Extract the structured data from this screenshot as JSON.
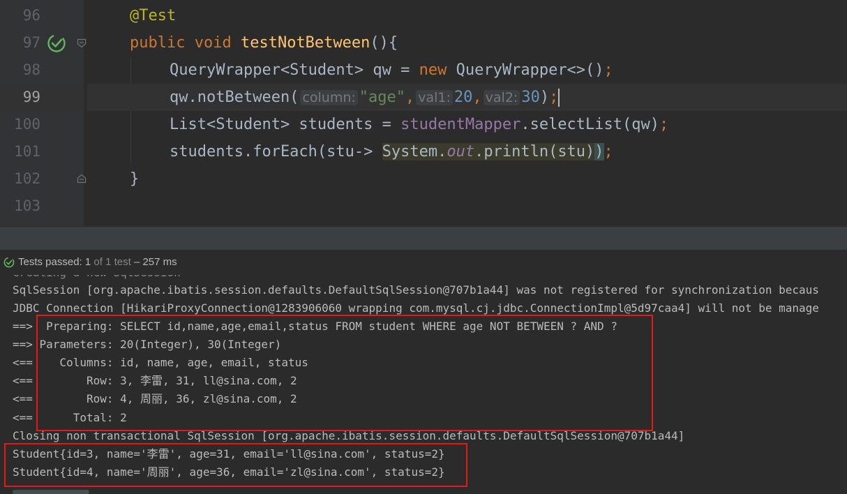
{
  "editor": {
    "line_numbers": [
      "96",
      "97",
      "98",
      "99",
      "100",
      "101",
      "102",
      "103"
    ],
    "current_line": "99",
    "code": {
      "l96_annotation": "@Test",
      "l97_kw_public": "public",
      "l97_kw_void": "void",
      "l97_method": "testNotBetween",
      "l97_rest": "(){",
      "l98_type": "QueryWrapper<Student> qw = ",
      "l98_kw_new": "new",
      "l98_rest": " QueryWrapper<>()",
      "l98_semi": ";",
      "l99_call": "qw.notBetween(",
      "l99_hint_column": "column:",
      "l99_arg_column": "\"age\"",
      "l99_comma1": ",",
      "l99_hint_val1": "val1:",
      "l99_arg_val1": "20",
      "l99_comma2": ",",
      "l99_hint_val2": "val2:",
      "l99_arg_val2": "30",
      "l99_close": ")",
      "l99_semi": ";",
      "l100_type": "List<Student> students = ",
      "l100_field": "studentMapper",
      "l100_rest": ".selectList(qw)",
      "l100_semi": ";",
      "l101_start": "students.forEach(stu-> ",
      "l101_system": "System.",
      "l101_out": "out",
      "l101_println": ".println(stu)",
      "l101_close": ")",
      "l101_semi": ";",
      "l102_brace": "}"
    }
  },
  "test_status": {
    "label": "Tests passed: ",
    "passed": "1",
    "of_total": " of 1 test",
    "duration": " – 257 ms"
  },
  "console": {
    "partial_top": "Creating a new SqlSession",
    "lines": [
      "SqlSession [org.apache.ibatis.session.defaults.DefaultSqlSession@707b1a44] was not registered for synchronization becaus",
      "JDBC Connection [HikariProxyConnection@1283906060 wrapping com.mysql.cj.jdbc.ConnectionImpl@5d97caa4] will not be manage",
      "==>  Preparing: SELECT id,name,age,email,status FROM student WHERE age NOT BETWEEN ? AND ?",
      "==> Parameters: 20(Integer), 30(Integer)",
      "<==    Columns: id, name, age, email, status",
      "<==        Row: 3, 李雷, 31, ll@sina.com, 2",
      "<==        Row: 4, 周丽, 36, zl@sina.com, 2",
      "<==      Total: 2",
      "Closing non transactional SqlSession [org.apache.ibatis.session.defaults.DefaultSqlSession@707b1a44]",
      "Student{id=3, name='李雷', age=31, email='ll@sina.com', status=2}",
      "Student{id=4, name='周丽', age=36, email='zl@sina.com', status=2}"
    ]
  },
  "colors": {
    "highlight_box": "#e81818",
    "pass_green": "#5fb85f"
  },
  "icons": {
    "gutter_run": "run-passed-check-icon",
    "status_check": "passed-check-icon"
  }
}
